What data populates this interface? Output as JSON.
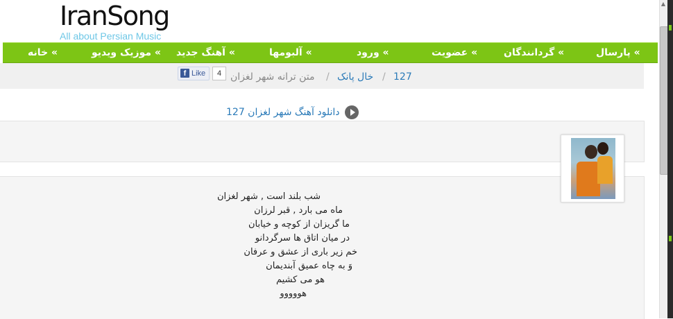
{
  "logo": {
    "title": "IranSong",
    "subtitle": "All about Persian Music"
  },
  "nav": {
    "items": [
      {
        "label": "» پارسال"
      },
      {
        "label": "» گردانندگان"
      },
      {
        "label": "» عضویت"
      },
      {
        "label": "» ورود"
      },
      {
        "label": "» آلبومها"
      },
      {
        "label": "» آهنگ جدید"
      },
      {
        "label": "» موزیک ویدیو"
      },
      {
        "label": "» خانه"
      }
    ]
  },
  "breadcrumb": {
    "item1": "127",
    "sep1": "/",
    "item2": "خال پانک",
    "sep2": "/",
    "current": "متن ترانه شهر لغزان"
  },
  "facebook": {
    "like_label": "Like",
    "count": "4"
  },
  "download": {
    "label": "دانلود آهنگ شهر لغزان 127",
    "icon": "play-icon"
  },
  "lyrics": [
    "شب بلند است , شهر لغزان",
    "ماه می بارد , قبر لرزان",
    "ما گریزان از کوچه و خیابان",
    "در میان اتاق ها سرگردانو",
    "خم زیر باری از عشق و عرفان",
    "وَ به چاه عمیق آبندیمان",
    "هو می کشیم",
    "هووووو"
  ],
  "colors": {
    "nav_bg": "#7dc515",
    "link": "#2a7ab8",
    "logo_sub": "#6ec7e6"
  }
}
